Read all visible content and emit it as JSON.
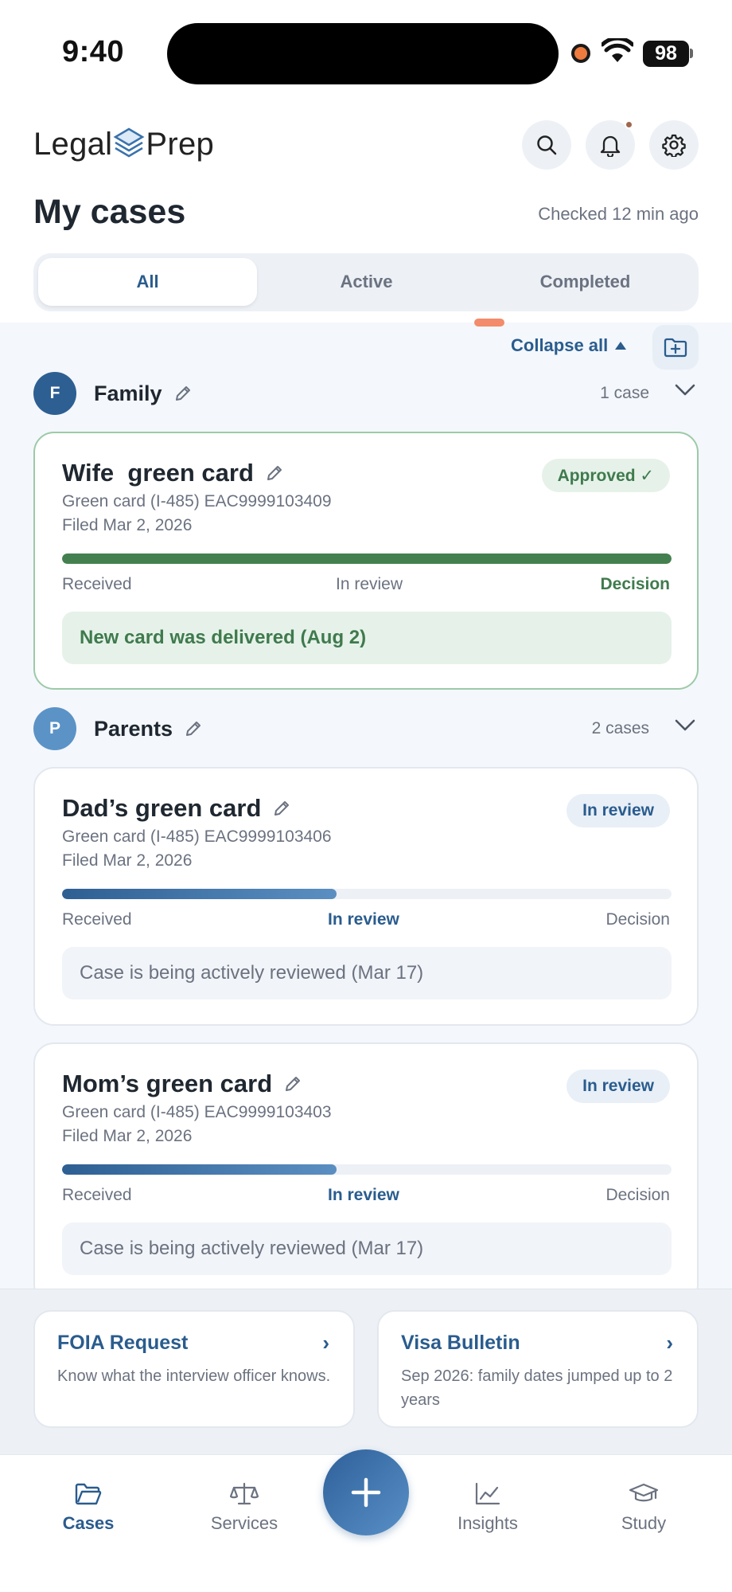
{
  "status_bar": {
    "time": "9:40",
    "battery": "98"
  },
  "header": {
    "logo_left": "Legal",
    "logo_right": "Prep",
    "title": "My cases",
    "checked": "Checked 12 min ago"
  },
  "tabs": [
    {
      "label": "All",
      "active": true
    },
    {
      "label": "Active",
      "active": false
    },
    {
      "label": "Completed",
      "active": false
    }
  ],
  "collapse_all": "Collapse all",
  "groups": [
    {
      "initial": "F",
      "name": "Family",
      "count": "1 case",
      "color": "#2e5f93",
      "cases": [
        {
          "title": "Wife  green card",
          "badge": "Approved ✓",
          "type": "Green card (I-485)  EAC9999103409",
          "filed": "Filed Mar 2, 2026",
          "progress": 1.0,
          "stages": [
            "Received",
            "In review",
            "Decision"
          ],
          "current_stage": 2,
          "note": "New card was delivered (Aug 2)"
        }
      ]
    },
    {
      "initial": "P",
      "name": "Parents",
      "count": "2 cases",
      "color": "#5b93c7",
      "cases": [
        {
          "title": "Dad’s green card",
          "badge": "In review",
          "type": "Green card (I-485)  EAC9999103406",
          "filed": "Filed Mar 2, 2026",
          "progress": 0.45,
          "stages": [
            "Received",
            "In review",
            "Decision"
          ],
          "current_stage": 1,
          "note": "Case is being actively reviewed (Mar 17)"
        },
        {
          "title": "Mom’s green card",
          "badge": "In review",
          "type": "Green card (I-485)  EAC9999103403",
          "filed": "Filed Mar 2, 2026",
          "progress": 0.45,
          "stages": [
            "Received",
            "In review",
            "Decision"
          ],
          "current_stage": 1,
          "note": "Case is being actively reviewed (Mar 17)"
        }
      ]
    }
  ],
  "promos": [
    {
      "title": "FOIA Request",
      "arrow": "›",
      "desc": "Know what the interview officer knows."
    },
    {
      "title": "Visa Bulletin",
      "arrow": "›",
      "desc": "Sep 2026: family dates jumped up to 2 years"
    }
  ],
  "tabbar": [
    {
      "label": "Cases",
      "icon": "folder-icon",
      "active": true
    },
    {
      "label": "Services",
      "icon": "scales-icon",
      "active": false
    },
    {
      "label": "Insights",
      "icon": "chart-icon",
      "active": false
    },
    {
      "label": "Study",
      "icon": "graduation-cap-icon",
      "active": false
    }
  ],
  "colors": {
    "accent": "#2a5c8e",
    "success": "#3f7a4d",
    "muted": "#6b7280"
  }
}
